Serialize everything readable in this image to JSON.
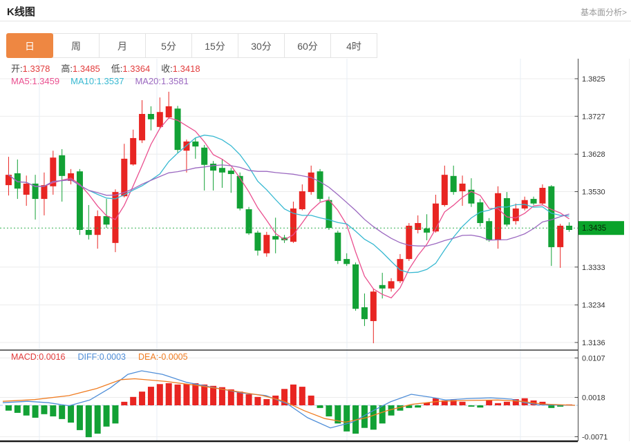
{
  "header": {
    "title": "K线图",
    "link": "基本面分析>"
  },
  "tabs": {
    "selected_index": 0,
    "items": [
      {
        "label": "日"
      },
      {
        "label": "周"
      },
      {
        "label": "月"
      },
      {
        "label": "5分"
      },
      {
        "label": "15分"
      },
      {
        "label": "30分"
      },
      {
        "label": "60分"
      },
      {
        "label": "4时"
      }
    ]
  },
  "info": {
    "ohlc": [
      {
        "label": "开:",
        "value": "1.3378"
      },
      {
        "label": "高:",
        "value": "1.3485"
      },
      {
        "label": "低:",
        "value": "1.3364"
      },
      {
        "label": "收:",
        "value": "1.3418"
      }
    ],
    "ma": [
      {
        "label": "MA5:",
        "value": "1.3459",
        "color": "#ea4f8f"
      },
      {
        "label": "MA10:",
        "value": "1.3537",
        "color": "#36b8d1"
      },
      {
        "label": "MA20:",
        "value": "1.3581",
        "color": "#9b68c0"
      }
    ],
    "macd": [
      {
        "label": "MACD:",
        "value": "0.0016",
        "color": "#e23b3b"
      },
      {
        "label": "DIFF:",
        "value": "0.0003",
        "color": "#4f8ed8"
      },
      {
        "label": "DEA:",
        "value": "-0.0005",
        "color": "#f07c21"
      }
    ]
  },
  "colors": {
    "tab_active_bg": "#ee8742",
    "up": "#e82522",
    "down": "#12a135",
    "ma5": "#ea4f8f",
    "ma10": "#36b8d1",
    "ma20": "#9b68c0",
    "diff": "#4f8ed8",
    "dea": "#f07c21",
    "value_red": "#e23b3b",
    "badge": "#0aa32a",
    "badge_text": "#062d06",
    "price_line": "#2eaf4e",
    "grid": "#ececec",
    "vgrid": "#e7eef5",
    "axis": "#444444",
    "zero_dash": "#aac9e9",
    "separator": "#3a3a3a",
    "bottom_line": "#1a1a1a"
  },
  "chart_data": {
    "type": "candlestick+macd",
    "title": "K线图 (daily)",
    "legend": [
      "MA5",
      "MA10",
      "MA20"
    ],
    "price_axis_ticks": [
      {
        "label": "1.3825",
        "value": 1.3825
      },
      {
        "label": "1.3727",
        "value": 1.3727
      },
      {
        "label": "1.3628",
        "value": 1.3628
      },
      {
        "label": "1.3530",
        "value": 1.353
      },
      {
        "label": "1.3333",
        "value": 1.3333
      },
      {
        "label": "1.3234",
        "value": 1.3234
      },
      {
        "label": "1.3136",
        "value": 1.3136
      }
    ],
    "current_price": {
      "label": "1.3435",
      "value": 1.3435
    },
    "ylim": [
      1.3116,
      1.3877
    ],
    "grid": true,
    "candles_ohlc": [
      [
        1.3547,
        1.3621,
        1.352,
        1.3574
      ],
      [
        1.3578,
        1.3614,
        1.3511,
        1.3538
      ],
      [
        1.3522,
        1.3572,
        1.3493,
        1.3551
      ],
      [
        1.3551,
        1.3574,
        1.3457,
        1.3511
      ],
      [
        1.3511,
        1.358,
        1.3468,
        1.3547
      ],
      [
        1.3544,
        1.3637,
        1.3522,
        1.3619
      ],
      [
        1.3625,
        1.3641,
        1.3504,
        1.3571
      ],
      [
        1.3558,
        1.3589,
        1.3549,
        1.3578
      ],
      [
        1.3583,
        1.3589,
        1.3417,
        1.343
      ],
      [
        1.343,
        1.3495,
        1.3405,
        1.3417
      ],
      [
        1.3417,
        1.3481,
        1.3381,
        1.3466
      ],
      [
        1.3466,
        1.3511,
        1.3435,
        1.3444
      ],
      [
        1.3396,
        1.3536,
        1.3372,
        1.3529
      ],
      [
        1.3518,
        1.3655,
        1.3515,
        1.3616
      ],
      [
        1.3601,
        1.3692,
        1.3598,
        1.367
      ],
      [
        1.3664,
        1.3769,
        1.3657,
        1.3733
      ],
      [
        1.3733,
        1.3753,
        1.369,
        1.3719
      ],
      [
        1.3699,
        1.3776,
        1.3695,
        1.3738
      ],
      [
        1.3724,
        1.3791,
        1.372,
        1.3753
      ],
      [
        1.3747,
        1.3754,
        1.363,
        1.3639
      ],
      [
        1.3637,
        1.3666,
        1.358,
        1.3661
      ],
      [
        1.3661,
        1.367,
        1.3616,
        1.3648
      ],
      [
        1.3645,
        1.3652,
        1.3533,
        1.36
      ],
      [
        1.3603,
        1.361,
        1.3533,
        1.3585
      ],
      [
        1.3592,
        1.3614,
        1.354,
        1.358
      ],
      [
        1.3585,
        1.3592,
        1.3527,
        1.3576
      ],
      [
        1.3571,
        1.358,
        1.3481,
        1.3486
      ],
      [
        1.3484,
        1.349,
        1.3417,
        1.3421
      ],
      [
        1.3423,
        1.3428,
        1.3363,
        1.3376
      ],
      [
        1.3369,
        1.3425,
        1.336,
        1.3417
      ],
      [
        1.3414,
        1.3462,
        1.3369,
        1.3405
      ],
      [
        1.341,
        1.3417,
        1.3396,
        1.3403
      ],
      [
        1.3399,
        1.3504,
        1.3396,
        1.3486
      ],
      [
        1.3484,
        1.3549,
        1.3481,
        1.3531
      ],
      [
        1.3529,
        1.3598,
        1.3522,
        1.358
      ],
      [
        1.3583,
        1.3589,
        1.3504,
        1.3511
      ],
      [
        1.3508,
        1.3517,
        1.343,
        1.3435
      ],
      [
        1.3423,
        1.3428,
        1.3341,
        1.3349
      ],
      [
        1.3354,
        1.3369,
        1.3336,
        1.3341
      ],
      [
        1.334,
        1.3345,
        1.3219,
        1.3224
      ],
      [
        1.3228,
        1.3264,
        1.3179,
        1.3197
      ],
      [
        1.3192,
        1.3277,
        1.3134,
        1.3269
      ],
      [
        1.3286,
        1.3318,
        1.3251,
        1.3277
      ],
      [
        1.3277,
        1.3304,
        1.3269,
        1.3296
      ],
      [
        1.3296,
        1.3367,
        1.3291,
        1.3354
      ],
      [
        1.3354,
        1.3448,
        1.3349,
        1.3441
      ],
      [
        1.343,
        1.3468,
        1.3421,
        1.3448
      ],
      [
        1.3434,
        1.3471,
        1.3403,
        1.3423
      ],
      [
        1.3426,
        1.3522,
        1.3423,
        1.3499
      ],
      [
        1.3495,
        1.3598,
        1.3491,
        1.3574
      ],
      [
        1.3571,
        1.3598,
        1.3522,
        1.3529
      ],
      [
        1.3531,
        1.3572,
        1.3493,
        1.3551
      ],
      [
        1.3535,
        1.3565,
        1.349,
        1.3499
      ],
      [
        1.3502,
        1.3511,
        1.3439,
        1.3448
      ],
      [
        1.3453,
        1.3461,
        1.3399,
        1.3403
      ],
      [
        1.3403,
        1.3544,
        1.3381,
        1.3526
      ],
      [
        1.3513,
        1.3529,
        1.3439,
        1.3444
      ],
      [
        1.3453,
        1.3499,
        1.3444,
        1.3486
      ],
      [
        1.3486,
        1.3517,
        1.3481,
        1.3508
      ],
      [
        1.3511,
        1.3517,
        1.3495,
        1.3499
      ],
      [
        1.3499,
        1.3549,
        1.3495,
        1.354
      ],
      [
        1.3544,
        1.3547,
        1.3336,
        1.3385
      ],
      [
        1.3385,
        1.3446,
        1.3331,
        1.3441
      ],
      [
        1.3441,
        1.345,
        1.3425,
        1.343
      ]
    ],
    "moving_averages": {
      "windows": [
        5,
        10,
        20
      ]
    },
    "macd": {
      "axis_ticks": [
        {
          "label": "0.0107",
          "value": 0.0107
        },
        {
          "label": "0.0018",
          "value": 0.0018
        },
        {
          "label": "-0.0071",
          "value": -0.0071
        }
      ],
      "histogram": [
        -0.0012,
        -0.0017,
        -0.0023,
        -0.0028,
        -0.002,
        -0.0025,
        -0.0031,
        -0.0039,
        -0.0056,
        -0.0072,
        -0.0064,
        -0.0048,
        -0.0041,
        0.0008,
        0.0019,
        0.0031,
        0.0042,
        0.0048,
        0.005,
        0.0047,
        0.0048,
        0.005,
        0.0047,
        0.0044,
        0.0041,
        0.0036,
        0.0031,
        0.0025,
        0.0019,
        0.0014,
        0.0022,
        0.0037,
        0.0047,
        0.0042,
        0.0022,
        -0.0006,
        -0.0025,
        -0.0041,
        -0.0059,
        -0.0064,
        -0.0051,
        -0.0055,
        -0.0041,
        -0.0023,
        -0.0012,
        -0.0006,
        -0.0005,
        0.0006,
        0.0016,
        0.0011,
        0.0012,
        0.0008,
        -0.0003,
        -0.0005,
        0.0011,
        0.0005,
        0.0008,
        0.0014,
        0.0016,
        0.0011,
        0.0008,
        -0.0006,
        -0.0003,
        0.0002
      ],
      "diff_points": [
        [
          4,
          0.0006
        ],
        [
          40,
          0.0009
        ],
        [
          70,
          0.0006
        ],
        [
          100,
          -0.0001
        ],
        [
          130,
          0.0012
        ],
        [
          160,
          0.004
        ],
        [
          185,
          0.007
        ],
        [
          205,
          0.0078
        ],
        [
          235,
          0.007
        ],
        [
          270,
          0.0052
        ],
        [
          310,
          0.004
        ],
        [
          350,
          0.0028
        ],
        [
          385,
          0.0022
        ],
        [
          415,
          0.0004
        ],
        [
          445,
          -0.0028
        ],
        [
          478,
          -0.0051
        ],
        [
          510,
          -0.0038
        ],
        [
          540,
          -0.0012
        ],
        [
          565,
          0.0008
        ],
        [
          595,
          0.0025
        ],
        [
          625,
          0.0018
        ],
        [
          645,
          0.0012
        ],
        [
          675,
          0.0015
        ],
        [
          710,
          0.0017
        ],
        [
          740,
          0.0014
        ],
        [
          760,
          0.0006
        ],
        [
          780,
          0.0001
        ],
        [
          832,
          0.0
        ]
      ],
      "dea_points": [
        [
          4,
          0.0009
        ],
        [
          50,
          0.0013
        ],
        [
          100,
          0.0022
        ],
        [
          140,
          0.0038
        ],
        [
          175,
          0.0058
        ],
        [
          195,
          0.006
        ],
        [
          240,
          0.0054
        ],
        [
          290,
          0.0044
        ],
        [
          340,
          0.0032
        ],
        [
          380,
          0.0022
        ],
        [
          410,
          0.001
        ],
        [
          440,
          -0.0012
        ],
        [
          470,
          -0.003
        ],
        [
          500,
          -0.0038
        ],
        [
          530,
          -0.0028
        ],
        [
          560,
          -0.0012
        ],
        [
          595,
          0.0002
        ],
        [
          635,
          0.0009
        ],
        [
          680,
          0.0011
        ],
        [
          720,
          0.0012
        ],
        [
          755,
          0.0009
        ],
        [
          785,
          0.0003
        ],
        [
          832,
          0.0
        ]
      ]
    }
  }
}
